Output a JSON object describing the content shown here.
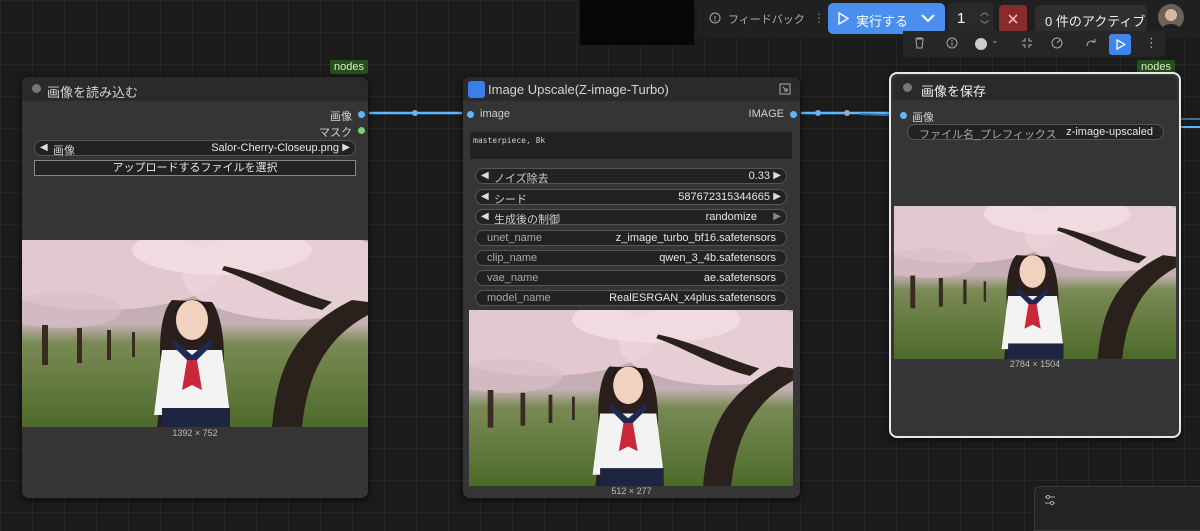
{
  "toolbar": {
    "feedback_label": "フィードバック",
    "run_label": "実行する",
    "batch_count": "1",
    "active_label": "0 件のアクティブ"
  },
  "badges": {
    "left": "nodes",
    "right": "nodes"
  },
  "node_load": {
    "title": "画像を読み込む",
    "output_image": "画像",
    "output_mask": "マスク",
    "image_widget": {
      "label": "画像",
      "value": "Salor-Cherry-Closeup.png"
    },
    "upload_button": "アップロードするファイルを選択",
    "image_dims": "1392 × 752"
  },
  "node_upscale": {
    "title": "Image Upscale(Z-image-Turbo)",
    "input_image": "image",
    "output_image": "IMAGE",
    "prompt": "masterpiece, 8k",
    "widgets": [
      {
        "label": "ノイズ除去",
        "value": "0.33"
      },
      {
        "label": "シード",
        "value": "587672315344665"
      },
      {
        "label": "生成後の制御",
        "value": "randomize"
      }
    ],
    "combos": [
      {
        "label": "unet_name",
        "value": "z_image_turbo_bf16.safetensors"
      },
      {
        "label": "clip_name",
        "value": "qwen_3_4b.safetensors"
      },
      {
        "label": "vae_name",
        "value": "ae.safetensors"
      },
      {
        "label": "model_name",
        "value": "RealESRGAN_x4plus.safetensors"
      }
    ],
    "image_dims": "512 × 277"
  },
  "node_save": {
    "title": "画像を保存",
    "input_image": "画像",
    "prefix_widget": {
      "label": "ファイル名_プレフィックス",
      "value": "z-image-upscaled"
    },
    "image_dims": "2784 × 1504"
  },
  "colors": {
    "accent": "#4a8ff0",
    "link": "#64b5f6",
    "mask": "#7bd17b",
    "badge": "#264f1e"
  }
}
